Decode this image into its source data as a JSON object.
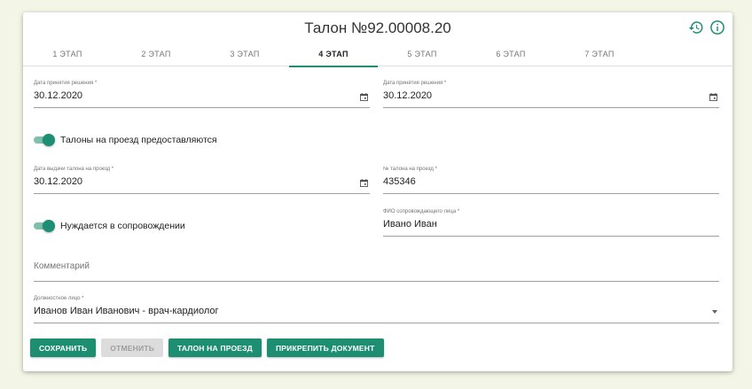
{
  "title": "Талон №92.00008.20",
  "icons": {
    "history": "history-icon",
    "info": "info-icon"
  },
  "colors": {
    "accent": "#1e8e73",
    "page_bg": "#f3f5e6"
  },
  "tabs": [
    {
      "label": "1 ЭТАП",
      "active": false
    },
    {
      "label": "2 ЭТАП",
      "active": false
    },
    {
      "label": "3 ЭТАП",
      "active": false
    },
    {
      "label": "4 ЭТАП",
      "active": true
    },
    {
      "label": "5 ЭТАП",
      "active": false
    },
    {
      "label": "6 ЭТАП",
      "active": false
    },
    {
      "label": "7 ЭТАП",
      "active": false
    }
  ],
  "form": {
    "decision_date_left": {
      "label": "Дата принятия решения *",
      "value": "30.12.2020"
    },
    "decision_date_right": {
      "label": "Дата принятия решения *",
      "value": "30.12.2020"
    },
    "tickets_provided": {
      "label": "Талоны на проезд предоставляются",
      "checked": true
    },
    "ticket_issue_date": {
      "label": "Дата выдачи талона на проезд *",
      "value": "30.12.2020"
    },
    "ticket_number": {
      "label": "№ талона на проезд *",
      "value": "435346"
    },
    "needs_escort": {
      "label": "Нуждается в сопровождении",
      "checked": true
    },
    "escort_name": {
      "label": "ФИО сопровождающего лица *",
      "value": "Ивано Иван"
    },
    "comment": {
      "placeholder": "Комментарий",
      "value": ""
    },
    "official": {
      "label": "Должностное лицо *",
      "value": "Иванов  Иван  Иванович  - врач-кардиолог"
    }
  },
  "buttons": {
    "save": "СОХРАНИТЬ",
    "cancel": "ОТМЕНИТЬ",
    "ticket": "ТАЛОН НА ПРОЕЗД",
    "attach": "ПРИКРЕПИТЬ ДОКУМЕНТ"
  }
}
